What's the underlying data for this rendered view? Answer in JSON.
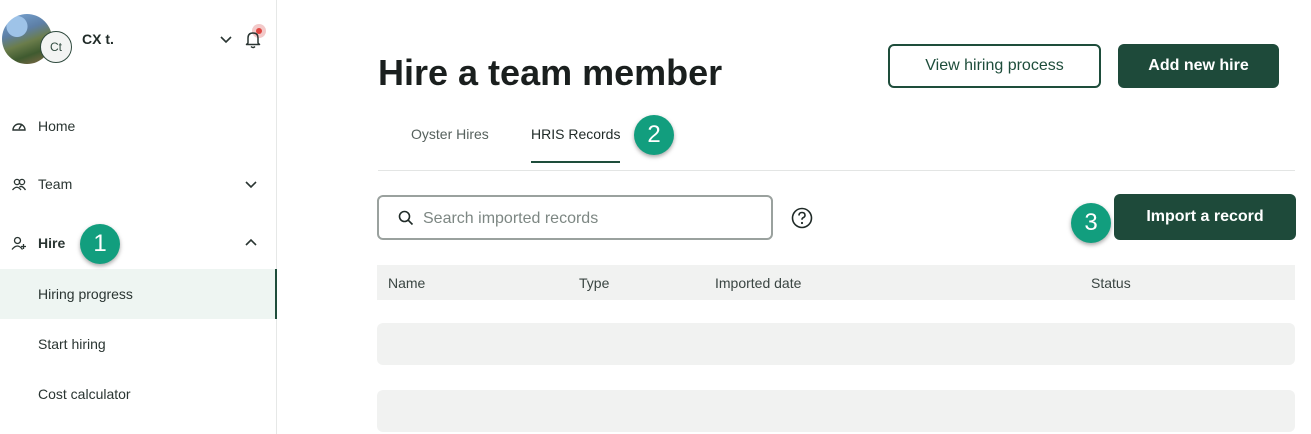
{
  "profile": {
    "name": "CX t.",
    "initials": "Ct"
  },
  "sidebar": {
    "items": [
      {
        "label": "Home",
        "icon": "speedometer-icon"
      },
      {
        "label": "Team",
        "icon": "team-icon"
      },
      {
        "label": "Hire",
        "icon": "add-person-icon"
      }
    ],
    "hire_subitems": [
      {
        "label": "Hiring progress",
        "active": true
      },
      {
        "label": "Start hiring",
        "active": false
      },
      {
        "label": "Cost calculator",
        "active": false
      }
    ]
  },
  "steps": {
    "one": "1",
    "two": "2",
    "three": "3"
  },
  "header": {
    "title": "Hire a team member",
    "view_process_label": "View hiring process",
    "add_hire_label": "Add new hire"
  },
  "tabs": [
    {
      "label": "Oyster Hires",
      "active": false
    },
    {
      "label": "HRIS Records",
      "active": true
    }
  ],
  "search": {
    "placeholder": "Search imported records",
    "value": ""
  },
  "import_label": "Import a record",
  "table": {
    "columns": [
      "Name",
      "Type",
      "Imported date",
      "Status"
    ]
  },
  "colors": {
    "brand_dark": "#1e4a3a",
    "step_badge": "#129e7e",
    "notification": "#e0453f"
  }
}
